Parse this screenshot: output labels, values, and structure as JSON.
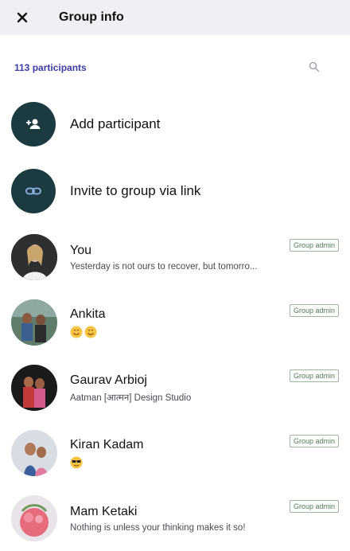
{
  "header": {
    "title": "Group info",
    "close_icon": "close-icon"
  },
  "participants_count": "113 participants",
  "actions": [
    {
      "label": "Add participant",
      "icon": "add-person-icon"
    },
    {
      "label": "Invite to group via link",
      "icon": "link-icon"
    }
  ],
  "members": [
    {
      "name": "You",
      "status": "Yesterday is not ours to recover, but tomorro...",
      "badge": "Group admin",
      "avatar": "avatar-you"
    },
    {
      "name": "Ankita",
      "status": "",
      "badge": "Group admin",
      "avatar": "avatar-ankita",
      "emoji": [
        "smile-emoji",
        "smile-emoji"
      ]
    },
    {
      "name": "Gaurav Arbioj",
      "status": "Aatman [आत्मन] Design Studio",
      "badge": "Group admin",
      "avatar": "avatar-gaurav"
    },
    {
      "name": "Kiran Kadam",
      "status": "",
      "badge": "Group admin",
      "avatar": "avatar-kiran",
      "emoji": [
        "sunglasses-emoji"
      ]
    },
    {
      "name": "Mam Ketaki",
      "status": "Nothing is unless your thinking makes it so!",
      "badge": "Group admin",
      "avatar": "avatar-ketaki"
    }
  ],
  "colors": {
    "accent": "#3c3ca8",
    "icon_bg": "#1c3b40",
    "header_bg": "#f1eff4"
  }
}
